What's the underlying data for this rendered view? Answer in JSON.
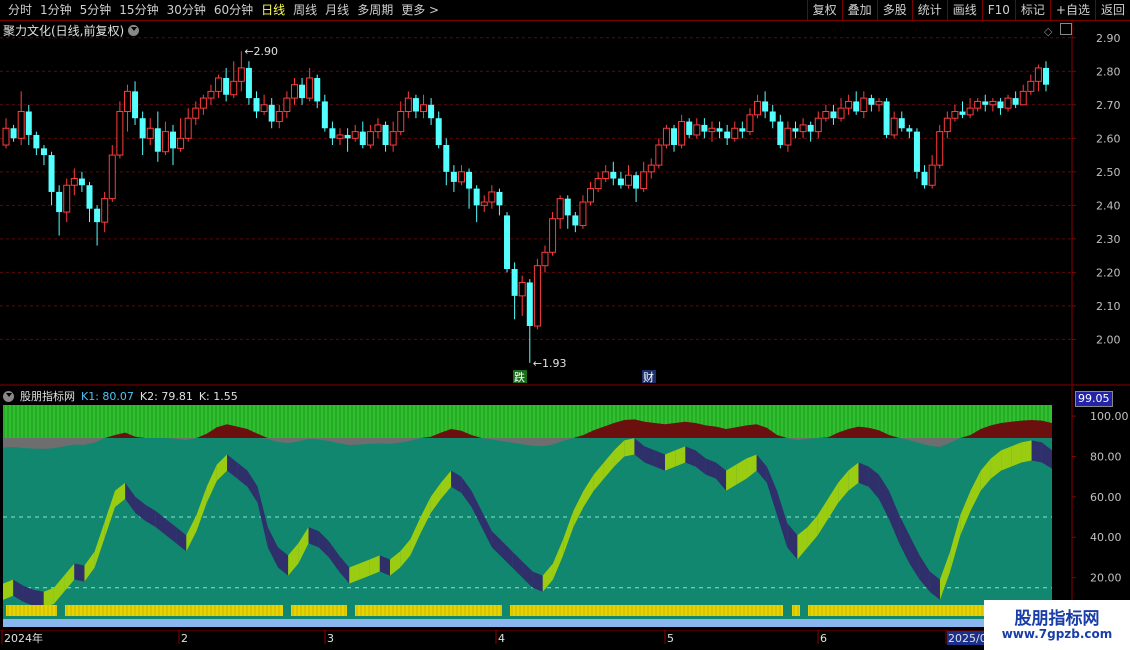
{
  "toolbar": {
    "periods": [
      "分时",
      "1分钟",
      "5分钟",
      "15分钟",
      "30分钟",
      "60分钟",
      "日线",
      "周线",
      "月线",
      "多周期",
      "更多 >"
    ],
    "active": "日线",
    "right_buttons": [
      "复权",
      "叠加",
      "多股",
      "统计",
      "画线",
      "F10",
      "标记",
      "+自选",
      "返回"
    ]
  },
  "main_chart": {
    "title": "聚力文化(日线,前复权)",
    "high_label": "2.90",
    "low_label": "1.93",
    "event_marks": [
      "跌",
      "财"
    ],
    "y_ticks": [
      "2.90",
      "2.80",
      "2.70",
      "2.60",
      "2.50",
      "2.40",
      "2.30",
      "2.20",
      "2.10",
      "2.00"
    ],
    "y_range": [
      1.87,
      2.95
    ]
  },
  "indicator": {
    "name": "股朋指标网",
    "k1": "K1: 80.07",
    "k2": "K2: 79.81",
    "k": "K: 1.55",
    "current_value": "99.05",
    "y_ticks": [
      "100.00",
      "80.00",
      "60.00",
      "40.00",
      "20.00"
    ]
  },
  "x_axis": {
    "labels": [
      "2024年",
      "2",
      "3",
      "4",
      "5",
      "6",
      "2025/0"
    ]
  },
  "watermark": {
    "title": "股朋指标网",
    "url": "www.7gpzb.com"
  },
  "colors": {
    "up": "#ff3c3c",
    "down": "#54ffff",
    "indicator_bg": "#10876e",
    "green_band": "#2fbf2f",
    "dark_red": "#6b0f0f",
    "lime": "#9acd12",
    "navy": "#2e2f6b",
    "yellow": "#e6d300",
    "light_blue": "#8ab6f0",
    "axis": "#8b0000"
  },
  "chart_data": {
    "type": "candlestick",
    "series": [
      {
        "values": [
          [
            2.58,
            2.63,
            2.57,
            2.66
          ],
          [
            2.63,
            2.6,
            2.59,
            2.64
          ],
          [
            2.6,
            2.68,
            2.58,
            2.74
          ],
          [
            2.68,
            2.61,
            2.58,
            2.7
          ],
          [
            2.61,
            2.57,
            2.55,
            2.62
          ],
          [
            2.57,
            2.55,
            2.52,
            2.58
          ],
          [
            2.55,
            2.44,
            2.4,
            2.56
          ],
          [
            2.44,
            2.38,
            2.31,
            2.46
          ],
          [
            2.38,
            2.46,
            2.35,
            2.48
          ],
          [
            2.46,
            2.48,
            2.43,
            2.51
          ],
          [
            2.48,
            2.46,
            2.44,
            2.5
          ],
          [
            2.46,
            2.39,
            2.35,
            2.47
          ],
          [
            2.39,
            2.35,
            2.28,
            2.4
          ],
          [
            2.35,
            2.42,
            2.32,
            2.44
          ],
          [
            2.42,
            2.55,
            2.41,
            2.58
          ],
          [
            2.55,
            2.68,
            2.54,
            2.71
          ],
          [
            2.68,
            2.74,
            2.62,
            2.76
          ],
          [
            2.74,
            2.66,
            2.64,
            2.77
          ],
          [
            2.66,
            2.6,
            2.55,
            2.68
          ],
          [
            2.6,
            2.63,
            2.58,
            2.66
          ],
          [
            2.63,
            2.56,
            2.53,
            2.68
          ],
          [
            2.56,
            2.62,
            2.55,
            2.65
          ],
          [
            2.62,
            2.57,
            2.52,
            2.64
          ],
          [
            2.57,
            2.6,
            2.56,
            2.66
          ],
          [
            2.6,
            2.66,
            2.59,
            2.69
          ],
          [
            2.66,
            2.69,
            2.64,
            2.71
          ],
          [
            2.69,
            2.72,
            2.67,
            2.73
          ],
          [
            2.72,
            2.74,
            2.7,
            2.76
          ],
          [
            2.74,
            2.78,
            2.72,
            2.79
          ],
          [
            2.78,
            2.73,
            2.71,
            2.81
          ],
          [
            2.73,
            2.77,
            2.72,
            2.83
          ],
          [
            2.77,
            2.81,
            2.74,
            2.86
          ],
          [
            2.81,
            2.72,
            2.7,
            2.83
          ],
          [
            2.72,
            2.68,
            2.66,
            2.74
          ],
          [
            2.68,
            2.7,
            2.67,
            2.73
          ],
          [
            2.7,
            2.65,
            2.63,
            2.72
          ],
          [
            2.65,
            2.68,
            2.63,
            2.7
          ],
          [
            2.68,
            2.72,
            2.66,
            2.74
          ],
          [
            2.72,
            2.76,
            2.7,
            2.78
          ],
          [
            2.76,
            2.72,
            2.7,
            2.78
          ],
          [
            2.72,
            2.78,
            2.71,
            2.81
          ],
          [
            2.78,
            2.71,
            2.69,
            2.79
          ],
          [
            2.71,
            2.63,
            2.62,
            2.73
          ],
          [
            2.63,
            2.6,
            2.58,
            2.65
          ],
          [
            2.6,
            2.61,
            2.58,
            2.63
          ],
          [
            2.61,
            2.6,
            2.56,
            2.63
          ],
          [
            2.6,
            2.62,
            2.59,
            2.64
          ],
          [
            2.62,
            2.58,
            2.57,
            2.65
          ],
          [
            2.58,
            2.62,
            2.57,
            2.64
          ],
          [
            2.62,
            2.64,
            2.6,
            2.66
          ],
          [
            2.64,
            2.58,
            2.56,
            2.65
          ],
          [
            2.58,
            2.62,
            2.56,
            2.65
          ],
          [
            2.62,
            2.68,
            2.61,
            2.71
          ],
          [
            2.68,
            2.72,
            2.66,
            2.74
          ],
          [
            2.72,
            2.68,
            2.66,
            2.73
          ],
          [
            2.68,
            2.7,
            2.66,
            2.73
          ],
          [
            2.7,
            2.66,
            2.64,
            2.72
          ],
          [
            2.66,
            2.58,
            2.57,
            2.68
          ],
          [
            2.58,
            2.5,
            2.46,
            2.6
          ],
          [
            2.5,
            2.47,
            2.44,
            2.52
          ],
          [
            2.47,
            2.5,
            2.46,
            2.52
          ],
          [
            2.5,
            2.45,
            2.39,
            2.51
          ],
          [
            2.45,
            2.4,
            2.35,
            2.46
          ],
          [
            2.4,
            2.41,
            2.38,
            2.43
          ],
          [
            2.41,
            2.44,
            2.39,
            2.46
          ],
          [
            2.44,
            2.4,
            2.37,
            2.45
          ],
          [
            2.37,
            2.21,
            2.2,
            2.38
          ],
          [
            2.21,
            2.13,
            2.06,
            2.23
          ],
          [
            2.13,
            2.17,
            2.07,
            2.19
          ],
          [
            2.17,
            2.04,
            1.93,
            2.18
          ],
          [
            2.04,
            2.22,
            2.03,
            2.24
          ],
          [
            2.22,
            2.26,
            2.2,
            2.28
          ],
          [
            2.26,
            2.36,
            2.25,
            2.38
          ],
          [
            2.36,
            2.42,
            2.33,
            2.43
          ],
          [
            2.42,
            2.37,
            2.33,
            2.43
          ],
          [
            2.37,
            2.34,
            2.32,
            2.38
          ],
          [
            2.34,
            2.41,
            2.33,
            2.43
          ],
          [
            2.41,
            2.45,
            2.4,
            2.47
          ],
          [
            2.45,
            2.48,
            2.44,
            2.5
          ],
          [
            2.48,
            2.5,
            2.47,
            2.52
          ],
          [
            2.5,
            2.48,
            2.46,
            2.53
          ],
          [
            2.48,
            2.46,
            2.45,
            2.5
          ],
          [
            2.46,
            2.49,
            2.45,
            2.52
          ],
          [
            2.49,
            2.45,
            2.41,
            2.5
          ],
          [
            2.45,
            2.5,
            2.44,
            2.53
          ],
          [
            2.5,
            2.52,
            2.48,
            2.54
          ],
          [
            2.52,
            2.58,
            2.51,
            2.6
          ],
          [
            2.58,
            2.63,
            2.57,
            2.64
          ],
          [
            2.63,
            2.58,
            2.56,
            2.64
          ],
          [
            2.58,
            2.65,
            2.57,
            2.67
          ],
          [
            2.65,
            2.61,
            2.6,
            2.66
          ],
          [
            2.61,
            2.64,
            2.6,
            2.66
          ],
          [
            2.64,
            2.62,
            2.6,
            2.66
          ],
          [
            2.62,
            2.63,
            2.59,
            2.65
          ],
          [
            2.63,
            2.62,
            2.6,
            2.65
          ],
          [
            2.62,
            2.6,
            2.58,
            2.64
          ],
          [
            2.6,
            2.63,
            2.59,
            2.65
          ],
          [
            2.63,
            2.62,
            2.6,
            2.65
          ],
          [
            2.62,
            2.67,
            2.61,
            2.69
          ],
          [
            2.67,
            2.71,
            2.66,
            2.73
          ],
          [
            2.71,
            2.68,
            2.66,
            2.74
          ],
          [
            2.68,
            2.65,
            2.63,
            2.7
          ],
          [
            2.65,
            2.58,
            2.57,
            2.67
          ],
          [
            2.58,
            2.63,
            2.56,
            2.65
          ],
          [
            2.63,
            2.62,
            2.6,
            2.65
          ],
          [
            2.62,
            2.64,
            2.6,
            2.66
          ],
          [
            2.64,
            2.62,
            2.59,
            2.65
          ],
          [
            2.62,
            2.66,
            2.6,
            2.68
          ],
          [
            2.66,
            2.68,
            2.65,
            2.7
          ],
          [
            2.68,
            2.66,
            2.64,
            2.7
          ],
          [
            2.66,
            2.69,
            2.65,
            2.72
          ],
          [
            2.69,
            2.71,
            2.67,
            2.73
          ],
          [
            2.71,
            2.68,
            2.67,
            2.74
          ],
          [
            2.68,
            2.72,
            2.66,
            2.74
          ],
          [
            2.72,
            2.7,
            2.68,
            2.73
          ],
          [
            2.7,
            2.71,
            2.68,
            2.72
          ],
          [
            2.71,
            2.61,
            2.6,
            2.72
          ],
          [
            2.61,
            2.66,
            2.6,
            2.68
          ],
          [
            2.66,
            2.63,
            2.62,
            2.68
          ],
          [
            2.63,
            2.62,
            2.6,
            2.64
          ],
          [
            2.62,
            2.5,
            2.48,
            2.63
          ],
          [
            2.5,
            2.46,
            2.45,
            2.52
          ],
          [
            2.46,
            2.52,
            2.45,
            2.55
          ],
          [
            2.52,
            2.62,
            2.51,
            2.64
          ],
          [
            2.62,
            2.66,
            2.6,
            2.68
          ],
          [
            2.66,
            2.68,
            2.65,
            2.7
          ],
          [
            2.68,
            2.67,
            2.66,
            2.71
          ],
          [
            2.67,
            2.69,
            2.66,
            2.72
          ],
          [
            2.69,
            2.71,
            2.68,
            2.72
          ],
          [
            2.71,
            2.7,
            2.68,
            2.73
          ],
          [
            2.7,
            2.71,
            2.68,
            2.72
          ],
          [
            2.71,
            2.69,
            2.67,
            2.72
          ],
          [
            2.69,
            2.72,
            2.68,
            2.73
          ],
          [
            2.72,
            2.7,
            2.69,
            2.74
          ],
          [
            2.7,
            2.74,
            2.7,
            2.76
          ],
          [
            2.74,
            2.77,
            2.73,
            2.79
          ],
          [
            2.77,
            2.81,
            2.74,
            2.82
          ],
          [
            2.81,
            2.76,
            2.74,
            2.83
          ]
        ]
      }
    ],
    "indicator_series": [
      {
        "name": "K1",
        "values": [
          14,
          16,
          13,
          11,
          10,
          12,
          18,
          24,
          23,
          30,
          45,
          60,
          64,
          57,
          53,
          50,
          46,
          42,
          38,
          48,
          62,
          73,
          78,
          74,
          70,
          62,
          42,
          32,
          28,
          34,
          42,
          40,
          35,
          28,
          22,
          24,
          26,
          28,
          26,
          30,
          36,
          47,
          57,
          64,
          70,
          67,
          60,
          50,
          40,
          35,
          30,
          25,
          20,
          18,
          24,
          36,
          50,
          60,
          68,
          74,
          80,
          85,
          86,
          82,
          80,
          78,
          80,
          82,
          80,
          76,
          74,
          70,
          73,
          76,
          78,
          72,
          60,
          44,
          38,
          42,
          48,
          56,
          64,
          70,
          74,
          72,
          68,
          60,
          48,
          38,
          28,
          20,
          16,
          30,
          48,
          60,
          70,
          76,
          80,
          82,
          84,
          85,
          84,
          80
        ]
      },
      {
        "name": "K2",
        "values": [
          12,
          14,
          11,
          9,
          8,
          10,
          16,
          22,
          21,
          28,
          43,
          58,
          62,
          55,
          51,
          48,
          44,
          40,
          36,
          46,
          60,
          71,
          76,
          72,
          68,
          60,
          38,
          28,
          24,
          30,
          40,
          38,
          33,
          26,
          20,
          22,
          24,
          26,
          24,
          28,
          34,
          45,
          55,
          62,
          68,
          65,
          58,
          48,
          38,
          33,
          28,
          23,
          18,
          16,
          22,
          34,
          48,
          58,
          66,
          72,
          78,
          83,
          84,
          80,
          78,
          76,
          78,
          80,
          78,
          74,
          72,
          66,
          69,
          72,
          76,
          70,
          54,
          38,
          32,
          38,
          44,
          52,
          60,
          66,
          70,
          68,
          62,
          52,
          40,
          30,
          22,
          16,
          12,
          26,
          44,
          56,
          66,
          72,
          76,
          78,
          80,
          81,
          80,
          77
        ]
      }
    ]
  }
}
